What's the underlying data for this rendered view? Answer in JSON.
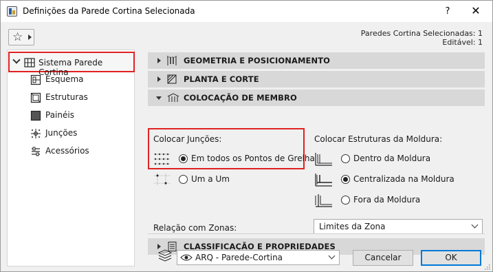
{
  "window": {
    "title": "Definições da Parede Cortina Selecionada",
    "help_label": "?",
    "close_label": "✕"
  },
  "header": {
    "selected_line1": "Paredes Cortina Selecionadas: 1",
    "selected_line2": "Editável: 1"
  },
  "tree": {
    "root": "Sistema Parede Cortina",
    "items": [
      {
        "label": "Esquema",
        "icon": "scheme-icon"
      },
      {
        "label": "Estruturas",
        "icon": "frames-icon"
      },
      {
        "label": "Painéis",
        "icon": "panels-icon"
      },
      {
        "label": "Junções",
        "icon": "junctions-icon"
      },
      {
        "label": "Acessórios",
        "icon": "accessories-icon"
      }
    ]
  },
  "sections": {
    "geometry": "GEOMETRIA E POSICIONAMENTO",
    "plan": "PLANTA E CORTE",
    "placement": "COLOCAÇÃO DE MEMBRO",
    "classification": "CLASSIFICAÇÃO E PROPRIEDADES"
  },
  "placement": {
    "junctions_label": "Colocar Junções:",
    "junction_options": [
      {
        "label": "Em todos os Pontos de Grelha",
        "checked": true
      },
      {
        "label": "Um a Um",
        "checked": false
      }
    ],
    "frames_label": "Colocar Estruturas da Moldura:",
    "frame_options": [
      {
        "label": "Dentro da Moldura",
        "checked": false
      },
      {
        "label": "Centralizada na Moldura",
        "checked": true
      },
      {
        "label": "Fora da Moldura",
        "checked": false
      }
    ]
  },
  "zones": {
    "label": "Relação com Zonas:",
    "value": "Limites da Zona"
  },
  "footer": {
    "layer_value": "ARQ - Parede-Cortina",
    "cancel_label": "Cancelar",
    "ok_label": "OK"
  },
  "colors": {
    "highlight": "#e02020",
    "section_bg": "#d8d8d8",
    "ok_border": "#0078d7"
  }
}
